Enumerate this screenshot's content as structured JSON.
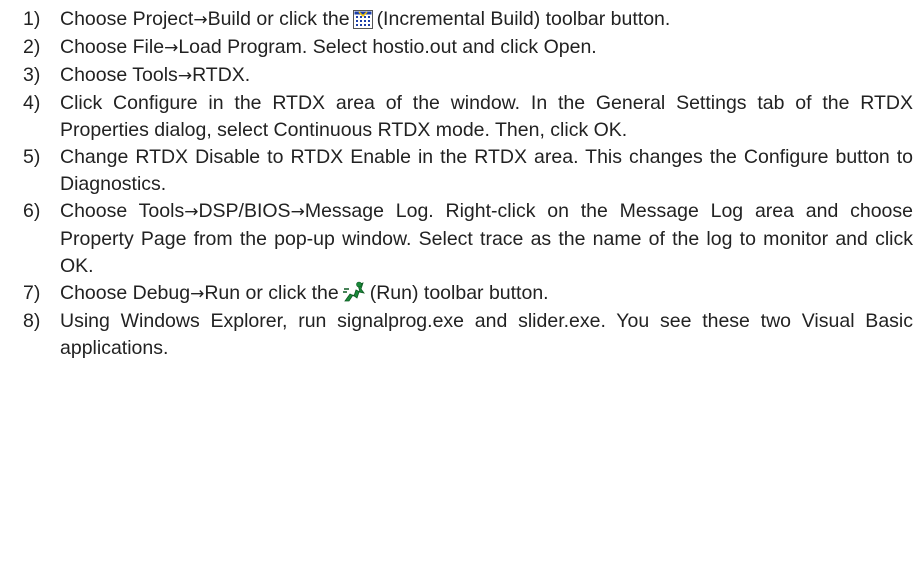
{
  "steps": [
    {
      "number": "1)",
      "parts": {
        "a": "Choose Project",
        "arrow": "→",
        "b": "Build or click the",
        "c": "(Incremental Build) toolbar button."
      },
      "icon": "incremental-build-icon"
    },
    {
      "number": "2)",
      "parts": {
        "a": "Choose File",
        "arrow": "→",
        "b": "Load Program. Select hostio.out and click Open."
      }
    },
    {
      "number": "3)",
      "parts": {
        "a": "Choose Tools",
        "arrow": "→",
        "b": "RTDX."
      }
    },
    {
      "number": "4)",
      "text": "Click Configure in the RTDX area of the window. In the General Settings tab of the RTDX Properties dialog, select Continuous RTDX mode. Then, click OK."
    },
    {
      "number": "5)",
      "text": "Change RTDX Disable to RTDX Enable in the RTDX area. This changes the Configure button to Diagnostics."
    },
    {
      "number": "6)",
      "parts": {
        "a": "Choose Tools",
        "arrow1": "→",
        "b": "DSP/BIOS",
        "arrow2": "→",
        "c": "Message Log. Right-click on the Message Log area and choose Property Page from the pop-up window. Select trace as the name of the log to monitor and click OK."
      }
    },
    {
      "number": "7)",
      "parts": {
        "a": "Choose Debug",
        "arrow": "→",
        "b": "Run or click the",
        "c": "(Run) toolbar button."
      },
      "icon": "run-icon"
    },
    {
      "number": "8)",
      "text": "Using Windows Explorer, run signalprog.exe and slider.exe. You see these two Visual Basic applications."
    }
  ],
  "colors": {
    "text": "#222222",
    "run_icon": "#1a8a3a",
    "build_icon_blue": "#1c3fa8"
  }
}
